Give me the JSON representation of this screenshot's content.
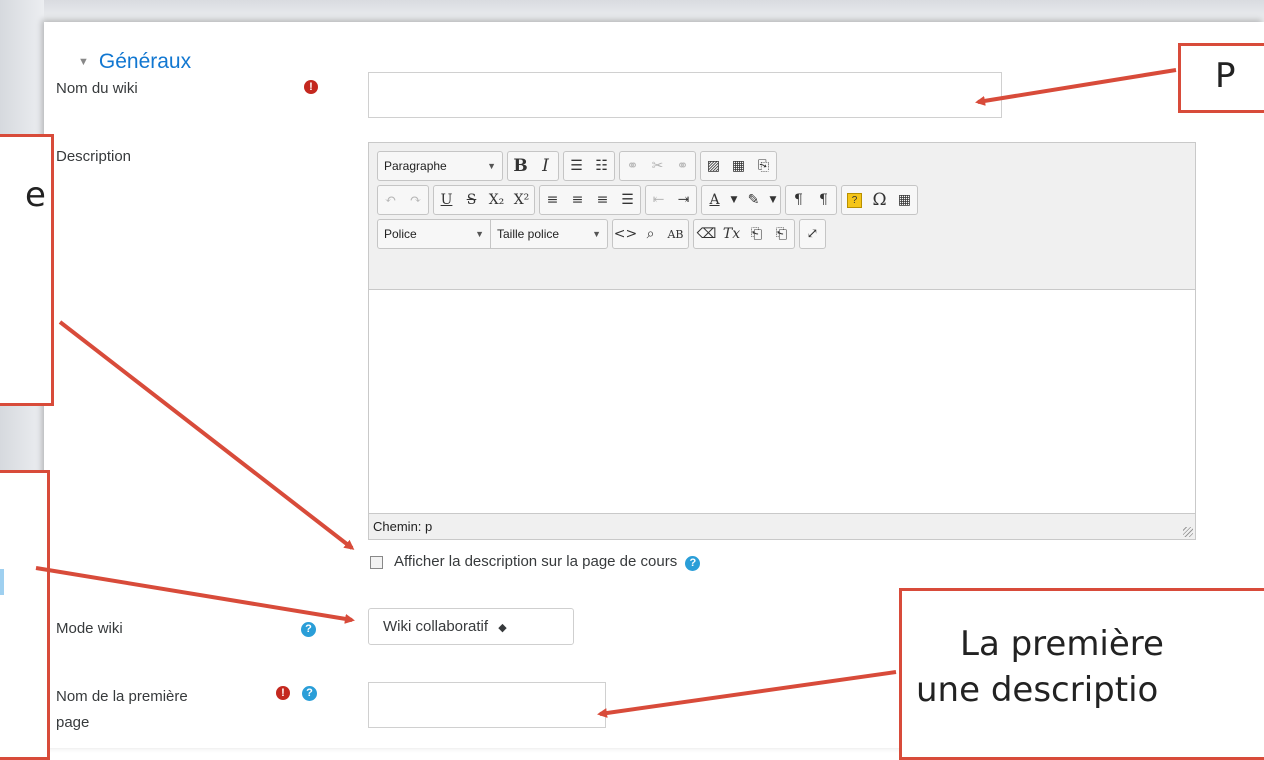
{
  "section": {
    "title": "Généraux"
  },
  "fields": {
    "name_label": "Nom du wiki",
    "description_label": "Description",
    "show_description_label": "Afficher la description sur la page de cours",
    "mode_label": "Mode wiki",
    "mode_value": "Wiki collaboratif",
    "first_page_label_line1": "Nom de la première",
    "first_page_label_line2": "page"
  },
  "editor": {
    "paragraph_select": "Paragraphe",
    "font_select": "Police",
    "size_select": "Taille police",
    "path_label": "Chemin: p"
  },
  "icons": {
    "required": "!",
    "help": "?"
  },
  "callouts": {
    "top_right_text": "P",
    "left_top_text": "e",
    "bottom_right_line1": "La première",
    "bottom_right_line2": "une descriptio"
  },
  "colors": {
    "accent": "#1177d1",
    "annotation": "#d84b3a",
    "required": "#c4281f",
    "help": "#2a9ed8"
  }
}
